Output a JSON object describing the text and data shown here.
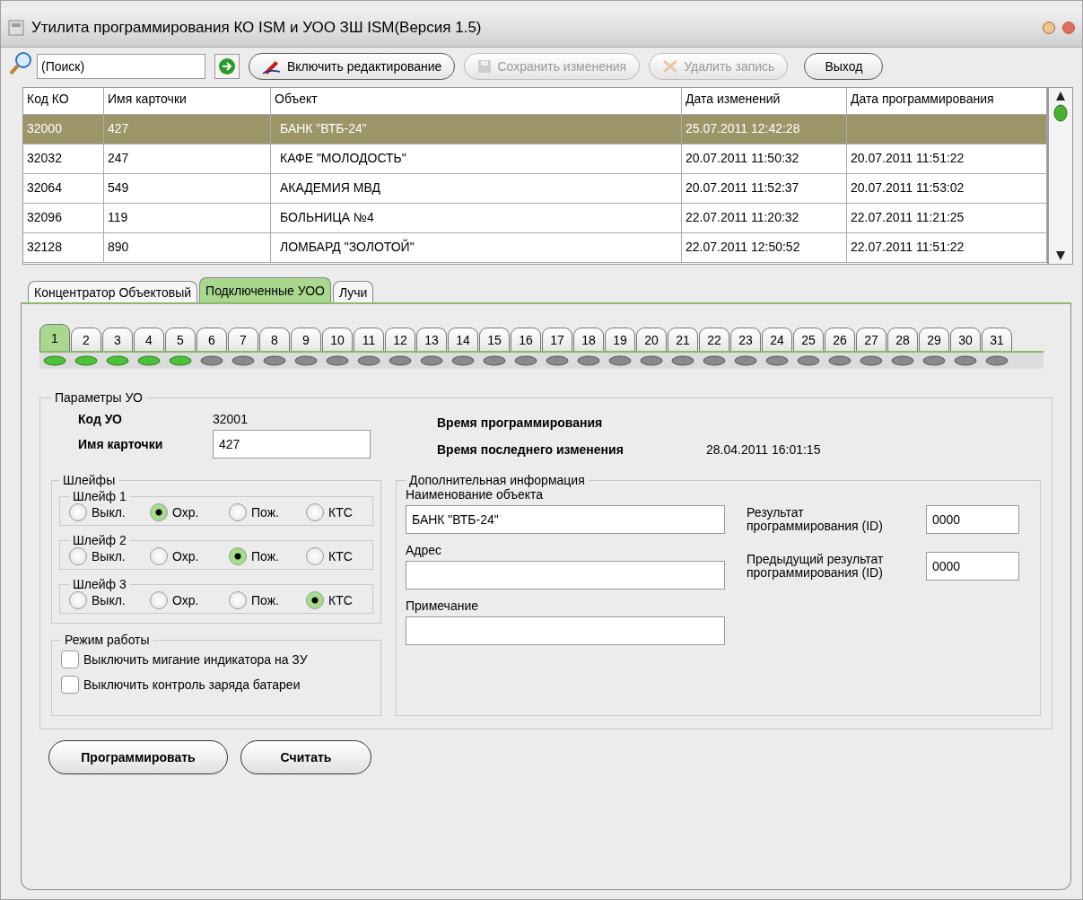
{
  "window": {
    "title": "Утилита программирования КО ISM и УОО ЗШ ISM(Версия 1.5)"
  },
  "toolbar": {
    "search": {
      "value": "(Поиск)"
    },
    "buttons": [
      {
        "kind": "edit",
        "label": "Включить редактирование",
        "disabled": false
      },
      {
        "kind": "save",
        "label": "Сохранить изменения",
        "disabled": true
      },
      {
        "kind": "delete",
        "label": "Удалить запись",
        "disabled": true
      },
      {
        "kind": "exit",
        "label": "Выход",
        "disabled": false
      }
    ]
  },
  "table": {
    "columns": [
      "Код КО",
      "Имя карточки",
      "Объект",
      "Дата изменений",
      "Дата программирования"
    ],
    "rows": [
      {
        "cells": [
          "32000",
          "427",
          "БАНК \"ВТБ-24\"",
          "25.07.2011 12:42:28",
          null
        ],
        "selected": true
      },
      {
        "cells": [
          "32032",
          "247",
          "КАФЕ \"МОЛОДОСТЬ\"",
          "20.07.2011 11:50:32",
          "20.07.2011 11:51:22"
        ],
        "selected": false
      },
      {
        "cells": [
          "32064",
          "549",
          "АКАДЕМИЯ МВД",
          "20.07.2011 11:52:37",
          "20.07.2011 11:53:02"
        ],
        "selected": false
      },
      {
        "cells": [
          "32096",
          "119",
          "БОЛЬНИЦА №4",
          "22.07.2011 11:20:32",
          "22.07.2011 11:21:25"
        ],
        "selected": false
      },
      {
        "cells": [
          "32128",
          "890",
          "ЛОМБАРД \"ЗОЛОТОЙ\"",
          "22.07.2011 12:50:52",
          "22.07.2011 11:51:22"
        ],
        "selected": false
      }
    ]
  },
  "tabs": [
    {
      "label": "Концентратор Объектовый",
      "selected": false
    },
    {
      "label": "Подключенные УОО",
      "selected": true
    },
    {
      "label": "Лучи",
      "selected": false
    }
  ],
  "devices": [
    {
      "label": "1",
      "selected": true,
      "online": true
    },
    {
      "label": "2",
      "selected": false,
      "online": true
    },
    {
      "label": "3",
      "selected": false,
      "online": true
    },
    {
      "label": "4",
      "selected": false,
      "online": true
    },
    {
      "label": "5",
      "selected": false,
      "online": true
    },
    {
      "label": "6",
      "selected": false,
      "online": false
    },
    {
      "label": "7",
      "selected": false,
      "online": false
    },
    {
      "label": "8",
      "selected": false,
      "online": false
    },
    {
      "label": "9",
      "selected": false,
      "online": false
    },
    {
      "label": "10",
      "selected": false,
      "online": false
    },
    {
      "label": "11",
      "selected": false,
      "online": false
    },
    {
      "label": "12",
      "selected": false,
      "online": false
    },
    {
      "label": "13",
      "selected": false,
      "online": false
    },
    {
      "label": "14",
      "selected": false,
      "online": false
    },
    {
      "label": "15",
      "selected": false,
      "online": false
    },
    {
      "label": "16",
      "selected": false,
      "online": false
    },
    {
      "label": "17",
      "selected": false,
      "online": false
    },
    {
      "label": "18",
      "selected": false,
      "online": false
    },
    {
      "label": "19",
      "selected": false,
      "online": false
    },
    {
      "label": "20",
      "selected": false,
      "online": false
    },
    {
      "label": "21",
      "selected": false,
      "online": false
    },
    {
      "label": "22",
      "selected": false,
      "online": false
    },
    {
      "label": "23",
      "selected": false,
      "online": false
    },
    {
      "label": "24",
      "selected": false,
      "online": false
    },
    {
      "label": "25",
      "selected": false,
      "online": false
    },
    {
      "label": "26",
      "selected": false,
      "online": false
    },
    {
      "label": "27",
      "selected": false,
      "online": false
    },
    {
      "label": "28",
      "selected": false,
      "online": false
    },
    {
      "label": "29",
      "selected": false,
      "online": false
    },
    {
      "label": "30",
      "selected": false,
      "online": false
    },
    {
      "label": "31",
      "selected": false,
      "online": false
    }
  ],
  "params": {
    "title": "Параметры УО",
    "code_label": "Код УО",
    "code_value": "32001",
    "card_label": "Имя карточки",
    "card_value": "427",
    "prog_time_label": "Время программирования",
    "change_time_label": "Время последнего изменения",
    "change_time_value": "28.04.2011 16:01:15",
    "loops": {
      "title": "Шлейфы",
      "items": [
        {
          "title": "Шлейф 1",
          "options": [
            {
              "label": "Выкл.",
              "selected": false
            },
            {
              "label": "Охр.",
              "selected": true
            },
            {
              "label": "Пож.",
              "selected": false
            },
            {
              "label": "КТС",
              "selected": false
            }
          ]
        },
        {
          "title": "Шлейф 2",
          "options": [
            {
              "label": "Выкл.",
              "selected": false
            },
            {
              "label": "Охр.",
              "selected": false
            },
            {
              "label": "Пож.",
              "selected": true
            },
            {
              "label": "КТС",
              "selected": false
            }
          ]
        },
        {
          "title": "Шлейф 3",
          "options": [
            {
              "label": "Выкл.",
              "selected": false
            },
            {
              "label": "Охр.",
              "selected": false
            },
            {
              "label": "Пож.",
              "selected": false
            },
            {
              "label": "КТС",
              "selected": true
            }
          ]
        }
      ]
    },
    "mode": {
      "title": "Режим работы",
      "options": [
        {
          "label": "Выключить мигание индикатора на ЗУ",
          "checked": false
        },
        {
          "label": "Выключить контроль заряда батареи",
          "checked": false
        }
      ]
    },
    "extra": {
      "title": "Дополнительная информация",
      "fields": [
        {
          "label": "Наименование объекта",
          "value": "БАНК \"ВТБ-24\""
        },
        {
          "label": "Адрес"
        },
        {
          "label": "Примечание"
        }
      ],
      "results": [
        {
          "label": "Результат программирования (ID)",
          "value": "0000"
        },
        {
          "label": "Предыдущий результат программирования (ID)",
          "value": "0000"
        }
      ]
    }
  },
  "actions": [
    "Программировать",
    "Считать"
  ]
}
